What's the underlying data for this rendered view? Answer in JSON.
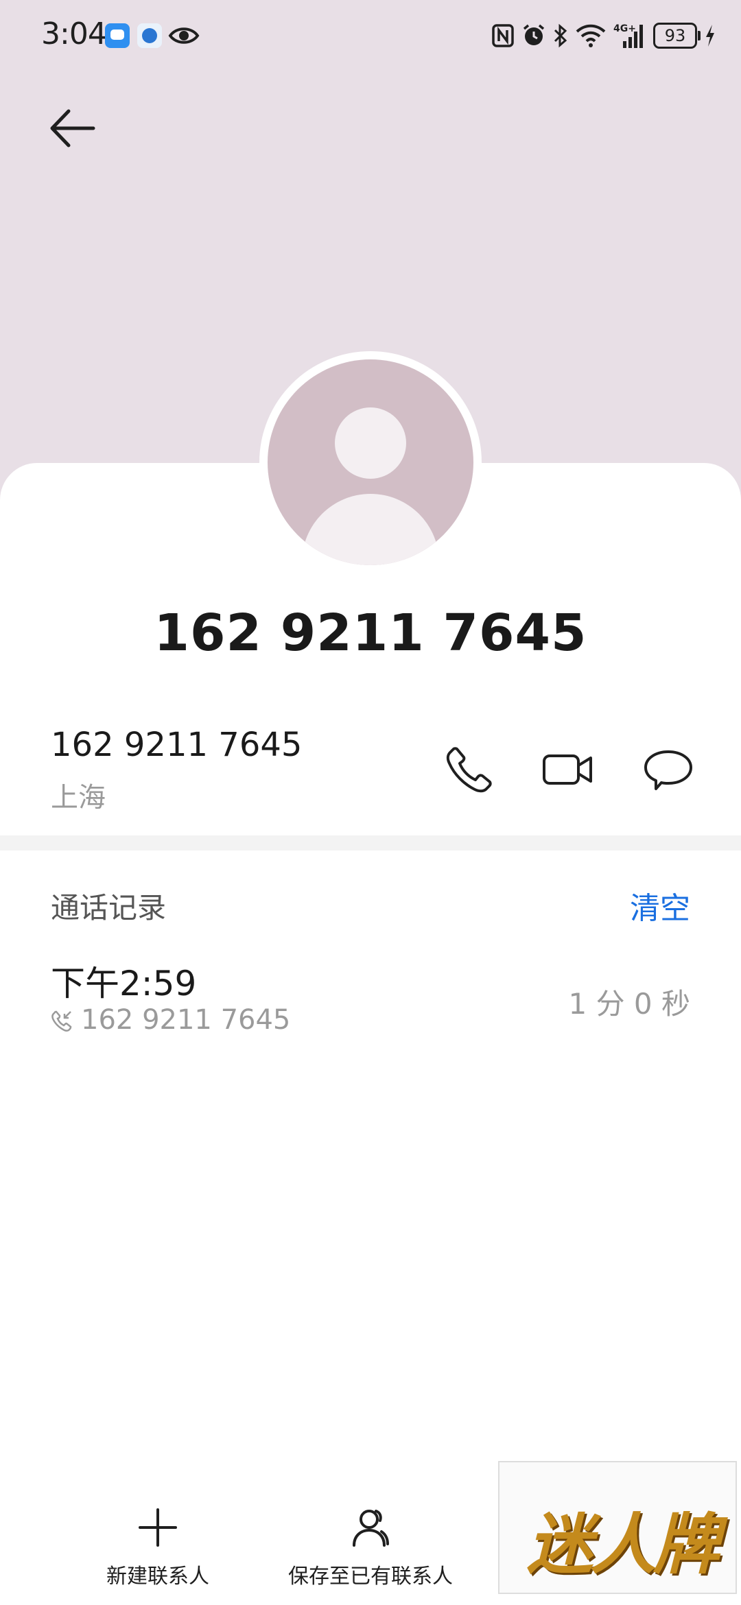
{
  "status_bar": {
    "time": "3:04",
    "battery": "93",
    "icons": [
      "message-app-icon",
      "browser-icon",
      "eye-icon",
      "nfc-icon",
      "alarm-icon",
      "bluetooth-icon",
      "wifi-icon",
      "4g-signal-icon",
      "battery-icon",
      "charging-icon"
    ]
  },
  "header": {
    "back_icon": "arrow-left-icon"
  },
  "contact": {
    "title": "162 9211 7645",
    "number": "162 9211 7645",
    "location": "上海",
    "actions": [
      "phone-icon",
      "video-icon",
      "message-icon"
    ]
  },
  "call_log": {
    "title": "通话记录",
    "clear_label": "清空",
    "entries": [
      {
        "time": "下午2:59",
        "number": "162 9211 7645",
        "duration": "1 分 0 秒"
      }
    ]
  },
  "bottom_bar": {
    "new_contact_label": "新建联系人",
    "save_existing_label": "保存至已有联系人"
  },
  "watermark": {
    "text": "迷人牌"
  },
  "colors": {
    "header_bg": "#e8dfe6",
    "avatar": "#d2bec6",
    "accent": "#1a6fe0"
  }
}
